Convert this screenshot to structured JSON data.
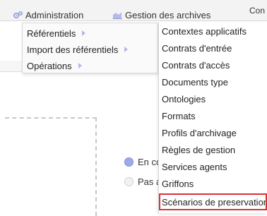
{
  "topbar": {
    "administration_label": "Administration",
    "gestion_label": "Gestion des archives",
    "right_label": "Con"
  },
  "menu": {
    "items": [
      {
        "label": "Référentiels",
        "has_submenu": true
      },
      {
        "label": "Import des référentiels",
        "has_submenu": true
      },
      {
        "label": "Opérations",
        "has_submenu": true
      }
    ]
  },
  "submenu": {
    "items": [
      {
        "label": "Contextes applicatifs"
      },
      {
        "label": "Contrats d'entrée"
      },
      {
        "label": "Contrats d'accès"
      },
      {
        "label": "Documents type"
      },
      {
        "label": "Ontologies"
      },
      {
        "label": "Formats"
      },
      {
        "label": "Profils d'archivage"
      },
      {
        "label": "Règles de gestion"
      },
      {
        "label": "Services agents"
      },
      {
        "label": "Griffons"
      },
      {
        "label": "Scénarios de preservation",
        "highlighted": true
      }
    ]
  },
  "form": {
    "radio_1": {
      "label": "En co",
      "checked": true
    },
    "radio_2": {
      "label": "Pas a",
      "checked": false
    }
  },
  "colors": {
    "accent": "#9fa8e8",
    "highlight_border": "#d9303a",
    "arrow": "#b5b8e6"
  }
}
